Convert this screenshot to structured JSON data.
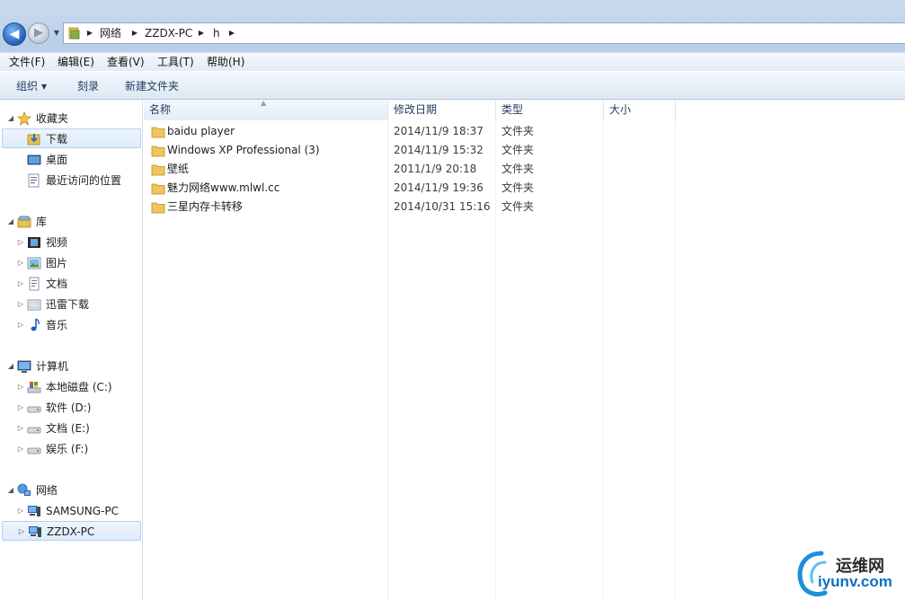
{
  "window": {
    "title_area": "",
    "breadcrumb": [
      "网络",
      "ZZDX-PC",
      "h"
    ]
  },
  "menu": [
    "文件(F)",
    "编辑(E)",
    "查看(V)",
    "工具(T)",
    "帮助(H)"
  ],
  "toolbar": {
    "organize_label": "组织",
    "burn_label": "刻录",
    "new_folder_label": "新建文件夹"
  },
  "nav": {
    "favorites": {
      "label": "收藏夹",
      "items": [
        "下载",
        "桌面",
        "最近访问的位置"
      ]
    },
    "libraries": {
      "label": "库",
      "items": [
        "视频",
        "图片",
        "文档",
        "迅雷下载",
        "音乐"
      ]
    },
    "computer": {
      "label": "计算机",
      "items": [
        "本地磁盘 (C:)",
        "软件 (D:)",
        "文档 (E:)",
        "娱乐 (F:)"
      ]
    },
    "network": {
      "label": "网络",
      "items": [
        "SAMSUNG-PC",
        "ZZDX-PC"
      ]
    },
    "selected_favorite": "下载",
    "selected_network": "ZZDX-PC"
  },
  "columns": {
    "name": "名称",
    "date": "修改日期",
    "type": "类型",
    "size": "大小"
  },
  "files": [
    {
      "name": "baidu player",
      "date": "2014/11/9 18:37",
      "type": "文件夹",
      "size": ""
    },
    {
      "name": "Windows XP Professional (3)",
      "date": "2014/11/9 15:32",
      "type": "文件夹",
      "size": ""
    },
    {
      "name": "壁纸",
      "date": "2011/1/9 20:18",
      "type": "文件夹",
      "size": ""
    },
    {
      "name": "魅力网络www.mlwl.cc",
      "date": "2014/11/9 19:36",
      "type": "文件夹",
      "size": ""
    },
    {
      "name": "三星内存卡转移",
      "date": "2014/10/31 15:16",
      "type": "文件夹",
      "size": ""
    }
  ],
  "watermark": {
    "top": "运维网",
    "bottom": "iyunv.com"
  },
  "colors": {
    "accent": "#1f5fb6",
    "folder": "#f2c55c",
    "selection": "#dcebfb"
  }
}
